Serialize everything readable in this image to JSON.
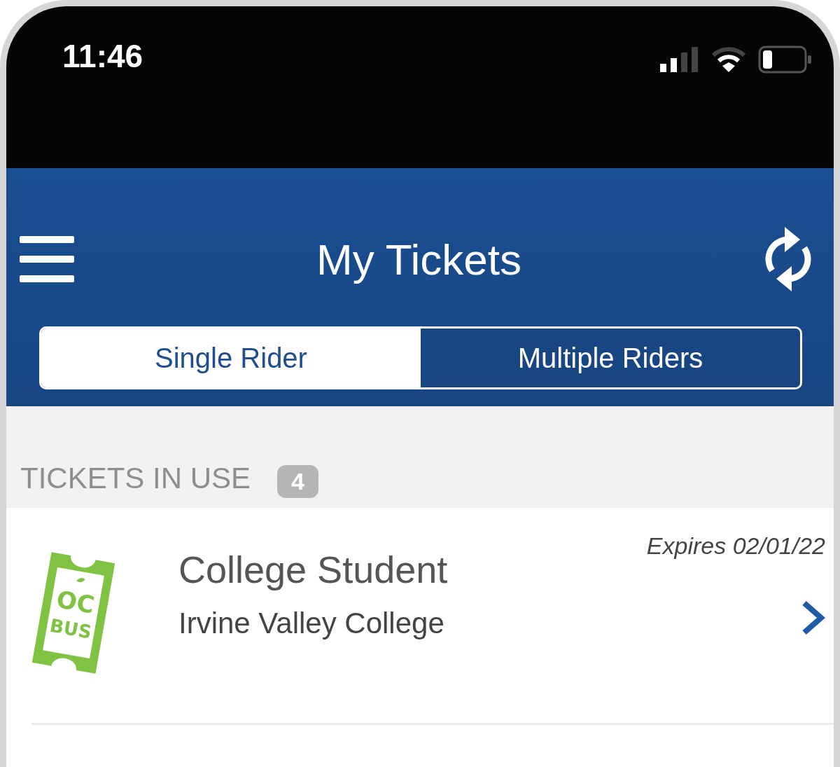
{
  "status_bar": {
    "time": "11:46"
  },
  "header": {
    "title": "My Tickets"
  },
  "tabs": [
    {
      "label": "Single Rider",
      "selected": true
    },
    {
      "label": "Multiple Riders",
      "selected": false
    }
  ],
  "section": {
    "title": "TICKETS IN USE",
    "count": "4"
  },
  "tickets": [
    {
      "logo_text": [
        "OC",
        "BUS"
      ],
      "name": "College Student",
      "place": "Irvine Valley College",
      "expires": "Expires 02/01/22"
    }
  ]
}
